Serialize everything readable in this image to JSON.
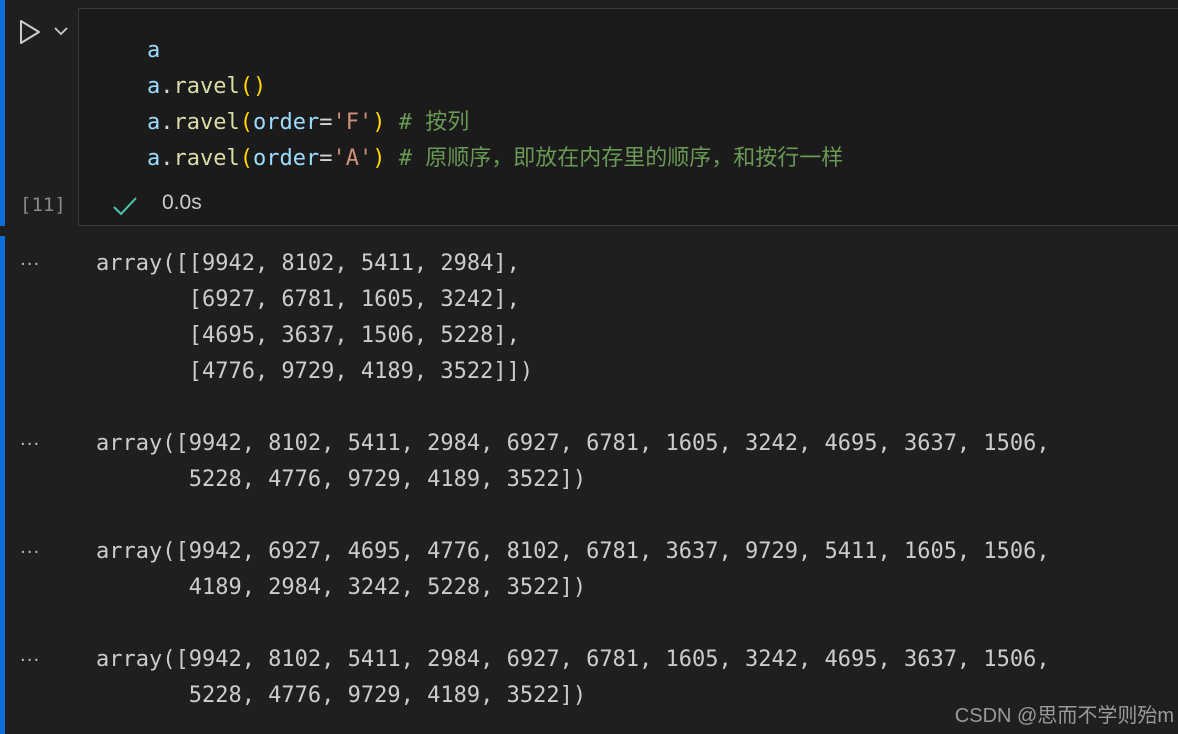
{
  "cell": {
    "execution_count": "[11]",
    "status_time": "0.0s",
    "code": {
      "line1": {
        "var": "a"
      },
      "line2": {
        "obj": "a",
        "dot": ".",
        "fn": "ravel",
        "open": "(",
        "close": ")"
      },
      "line3": {
        "obj": "a",
        "dot": ".",
        "fn": "ravel",
        "open": "(",
        "arg": "order",
        "eq": "=",
        "str": "'F'",
        "close": ")",
        "comment": " # 按列"
      },
      "line4": {
        "obj": "a",
        "dot": ".",
        "fn": "ravel",
        "open": "(",
        "arg": "order",
        "eq": "=",
        "str": "'A'",
        "close": ")",
        "comment": " # 原顺序，即放在内存里的顺序，和按行一样"
      }
    }
  },
  "outputs": [
    {
      "more": "···",
      "lines": [
        "array([[9942, 8102, 5411, 2984],",
        "       [6927, 6781, 1605, 3242],",
        "       [4695, 3637, 1506, 5228],",
        "       [4776, 9729, 4189, 3522]])"
      ]
    },
    {
      "more": "···",
      "lines": [
        "array([9942, 8102, 5411, 2984, 6927, 6781, 1605, 3242, 4695, 3637, 1506,",
        "       5228, 4776, 9729, 4189, 3522])"
      ]
    },
    {
      "more": "···",
      "lines": [
        "array([9942, 6927, 4695, 4776, 8102, 6781, 3637, 9729, 5411, 1605, 1506,",
        "       4189, 2984, 3242, 5228, 3522])"
      ]
    },
    {
      "more": "···",
      "lines": [
        "array([9942, 8102, 5411, 2984, 6927, 6781, 1605, 3242, 4695, 3637, 1506,",
        "       5228, 4776, 9729, 4189, 3522])"
      ]
    }
  ],
  "icons": {
    "run": "play-icon",
    "run_menu": "chevron-down-icon",
    "status": "checkmark-icon"
  },
  "colors": {
    "accent": "#0a6fd8",
    "background": "#1f1f1f",
    "success": "#4ec9b0"
  },
  "watermark": "CSDN @思而不学则殆m"
}
